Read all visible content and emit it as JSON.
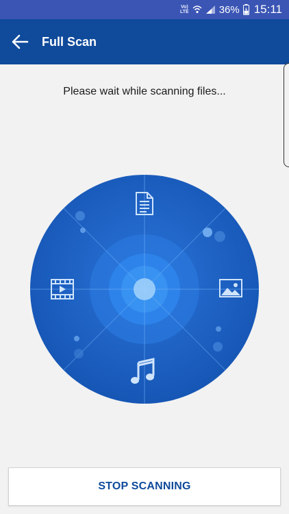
{
  "status_bar": {
    "network_label": "Vo) LTE",
    "battery_percent": "36%",
    "time": "15:11",
    "icons": [
      "volte-lte-icon",
      "wifi-icon",
      "signal-icon",
      "battery-icon"
    ]
  },
  "header": {
    "back_icon": "arrow-left-icon",
    "title": "Full Scan"
  },
  "main": {
    "message": "Please wait while scanning files...",
    "scan_categories": [
      "document-icon",
      "image-icon",
      "music-icon",
      "video-icon"
    ]
  },
  "footer": {
    "stop_label": "STOP SCANNING"
  },
  "colors": {
    "status_bar": "#3a55b4",
    "app_bar": "#0f4a9b",
    "radar_outer": "#1a5fc4",
    "accent_text": "#0f4a9b",
    "background": "#f2f2f2"
  }
}
